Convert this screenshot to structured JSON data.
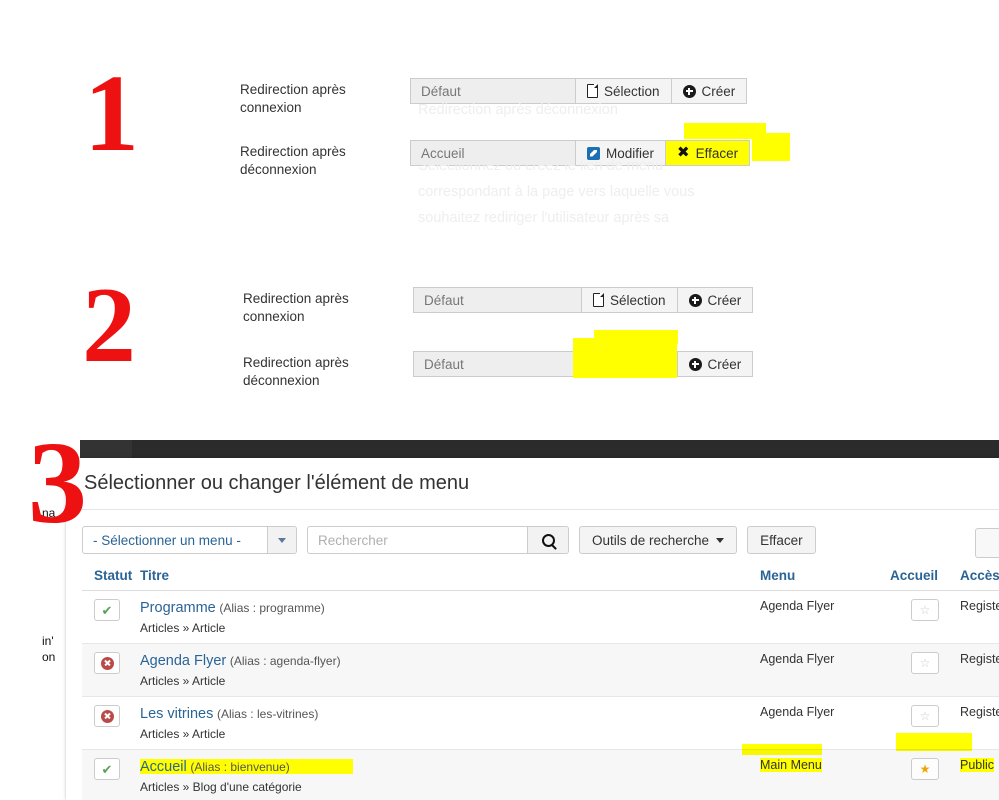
{
  "steps": {
    "one": "1",
    "two": "2",
    "three": "3"
  },
  "section1": {
    "ghost_tooltip_lines": [
      "Redirection après déconnexion",
      "Sélectionnez ou créez le lien de menu",
      "correspondant à la page vers laquelle vous",
      "souhaitez rediriger l'utilisateur après sa"
    ],
    "rows": [
      {
        "label": "Redirection après connexion",
        "value": "Défaut",
        "buttons": [
          {
            "label": "Sélection",
            "icon": "file-icon"
          },
          {
            "label": "Créer",
            "icon": "plus-circle-icon"
          }
        ]
      },
      {
        "label": "Redirection après déconnexion",
        "value": "Accueil",
        "buttons": [
          {
            "label": "Modifier",
            "icon": "pencil-icon"
          },
          {
            "label": "Effacer",
            "icon": "x-icon"
          }
        ]
      }
    ]
  },
  "section2": {
    "rows": [
      {
        "label": "Redirection après connexion",
        "value": "Défaut",
        "buttons": [
          {
            "label": "Sélection",
            "icon": "file-icon"
          },
          {
            "label": "Créer",
            "icon": "plus-circle-icon"
          }
        ]
      },
      {
        "label": "Redirection après déconnexion",
        "value": "Défaut",
        "buttons": [
          {
            "label": "Sélection",
            "icon": "file-icon"
          },
          {
            "label": "Créer",
            "icon": "plus-circle-icon"
          }
        ]
      }
    ]
  },
  "section3": {
    "background_text": [
      "na",
      "in'",
      "on"
    ],
    "modal_title": "Sélectionner ou changer l'élément de menu",
    "toolbar": {
      "menu_select_value": "- Sélectionner un menu -",
      "search_placeholder": "Rechercher",
      "search_value": "",
      "search_icon": "search-icon",
      "search_tools_label": "Outils de recherche",
      "clear_label": "Effacer"
    },
    "table": {
      "headers": {
        "status": "Statut",
        "title": "Titre",
        "menu": "Menu",
        "home": "Accueil",
        "access": "Accès"
      },
      "rows": [
        {
          "status": "published",
          "status_icon": "check-icon",
          "title": "Programme",
          "alias": "(Alias : programme)",
          "path": "Articles » Article",
          "menu": "Agenda Flyer",
          "home": false,
          "home_icon": "star-outline-icon",
          "access": "Registere"
        },
        {
          "status": "unpublished",
          "status_icon": "cancel-icon",
          "title": "Agenda Flyer",
          "alias": "(Alias : agenda-flyer)",
          "path": "Articles » Article",
          "menu": "Agenda Flyer",
          "home": false,
          "home_icon": "star-outline-icon",
          "access": "Registere"
        },
        {
          "status": "unpublished",
          "status_icon": "cancel-icon",
          "title": "Les vitrines",
          "alias": "(Alias : les-vitrines)",
          "path": "Articles » Article",
          "menu": "Agenda Flyer",
          "home": false,
          "home_icon": "star-outline-icon",
          "access": "Registere"
        },
        {
          "status": "published",
          "status_icon": "check-icon",
          "title": "Accueil",
          "alias": "(Alias : bienvenue)",
          "path": "Articles » Blog d'une catégorie",
          "menu": "Main Menu",
          "home": true,
          "home_icon": "star-filled-icon",
          "access": "Public"
        }
      ]
    }
  },
  "colors": {
    "annotation_red": "#ee1111",
    "highlight_yellow": "#ffff00",
    "link_blue": "#2a6496",
    "published_green": "#5aa05a",
    "unpublished_red": "#b94a48",
    "home_star_gold": "#f0a500",
    "admin_dark": "#2b2b2b"
  }
}
